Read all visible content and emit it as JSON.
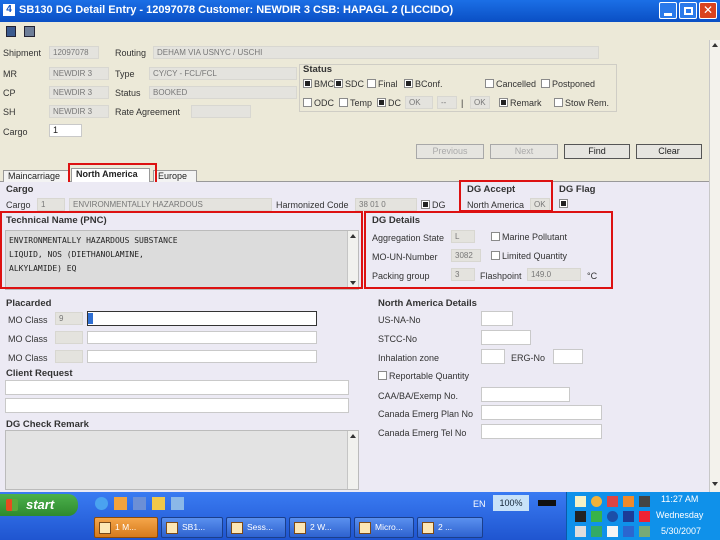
{
  "window": {
    "title": "SB130 DG Detail Entry - 12097078 Customer: NEWDIR 3 CSB: HAPAGL 2 (LICCIDO)"
  },
  "header": {
    "shipment_label": "Shipment",
    "shipment_value": "12097078",
    "routing_label": "Routing",
    "routing_value": "DEHAM VIA USNYC / USCHI",
    "mr_label": "MR",
    "mr_value": "NEWDIR 3",
    "type_label": "Type",
    "type_value": "CY/CY - FCL/FCL",
    "cp_label": "CP",
    "cp_value": "NEWDIR 3",
    "status_label": "Status",
    "status_value": "BOOKED",
    "sh_label": "SH",
    "sh_value": "NEWDIR 3",
    "rate_agreement_label": "Rate Agreement",
    "cargo_label": "Cargo",
    "cargo_value": "1"
  },
  "status_group": {
    "title": "Status",
    "row1": [
      {
        "label": "BMC",
        "checked": true
      },
      {
        "label": "SDC",
        "checked": true
      },
      {
        "label": "Final",
        "checked": false
      },
      {
        "label": "BConf.",
        "checked": true
      },
      {
        "label": "Cancelled",
        "checked": false
      },
      {
        "label": "Postponed",
        "checked": false
      }
    ],
    "row2": [
      {
        "label": "ODC",
        "checked": false
      },
      {
        "label": "Temp",
        "checked": false
      },
      {
        "label": "DC",
        "checked": true
      },
      {
        "label": "Remark",
        "checked": true
      },
      {
        "label": "Stow Rem.",
        "checked": false
      }
    ],
    "dc_value": "OK",
    "dc_dash": "--",
    "dc_ok2": "OK"
  },
  "buttons": {
    "previous": "Previous",
    "next": "Next",
    "find": "Find",
    "clear": "Clear"
  },
  "tabs": [
    "Maincarriage",
    "North America",
    "Europe"
  ],
  "cargo_row": {
    "title": "Cargo",
    "cargo_label": "Cargo",
    "cargo_value": "1",
    "cargo_desc": "ENVIRONMENTALLY HAZARDOUS",
    "harmonized_label": "Harmonized Code",
    "harmonized_value": "38 01 0",
    "dg_checkbox_label": "DG",
    "dg_checked": true
  },
  "dg_accept": {
    "title": "DG Accept",
    "value": "North America",
    "status": "OK"
  },
  "dg_flag": {
    "title": "DG Flag",
    "checked": true
  },
  "technical_name": {
    "title": "Technical Name (PNC)",
    "text": "ENVIRONMENTALLY HAZARDOUS SUBSTANCE\nLIQUID, NOS (DIETHANOLAMINE,\nALKYLAMIDE) EQ"
  },
  "dg_details": {
    "title": "DG Details",
    "aggregation_label": "Aggregation State",
    "aggregation_value": "L",
    "marine_pollutant_label": "Marine Pollutant",
    "marine_pollutant_checked": false,
    "un_number_label": "MO-UN-Number",
    "un_number_value": "3082",
    "limited_qty_label": "Limited Quantity",
    "limited_qty_checked": false,
    "packing_label": "Packing group",
    "packing_value": "3",
    "flashpoint_label": "Flashpoint",
    "flashpoint_value": "149.0",
    "flashpoint_unit": "°C"
  },
  "placarded": {
    "title": "Placarded",
    "rows": [
      {
        "label": "MO Class",
        "value": "9"
      },
      {
        "label": "MO Class",
        "value": ""
      },
      {
        "label": "MO Class",
        "value": ""
      }
    ]
  },
  "client_request": {
    "title": "Client Request"
  },
  "dg_check_remark": {
    "title": "DG Check Remark"
  },
  "na_details": {
    "title": "North America Details",
    "usna_label": "US-NA-No",
    "stcc_label": "STCC-No",
    "inhalation_label": "Inhalation zone",
    "erg_label": "ERG-No",
    "reportable_label": "Reportable Quantity",
    "caa_label": "CAA/BA/Exemp No.",
    "canada_plan_label": "Canada Emerg Plan No",
    "canada_tel_label": "Canada Emerg Tel No"
  },
  "taskbar": {
    "start_label": "start",
    "lang": "EN",
    "zoom": "100%",
    "clock_time": "11:27 AM",
    "clock_day": "Wednesday",
    "clock_date": "5/30/2007",
    "tasks": [
      "1 M...",
      "SB1...",
      "Sess...",
      "2 W...",
      "Micro...",
      "2 ..."
    ]
  },
  "colors": {
    "title_bar": "#0a5ed7",
    "highlight": "#d11111",
    "taskbar": "#245edb",
    "start_button": "#3c9a3c"
  }
}
